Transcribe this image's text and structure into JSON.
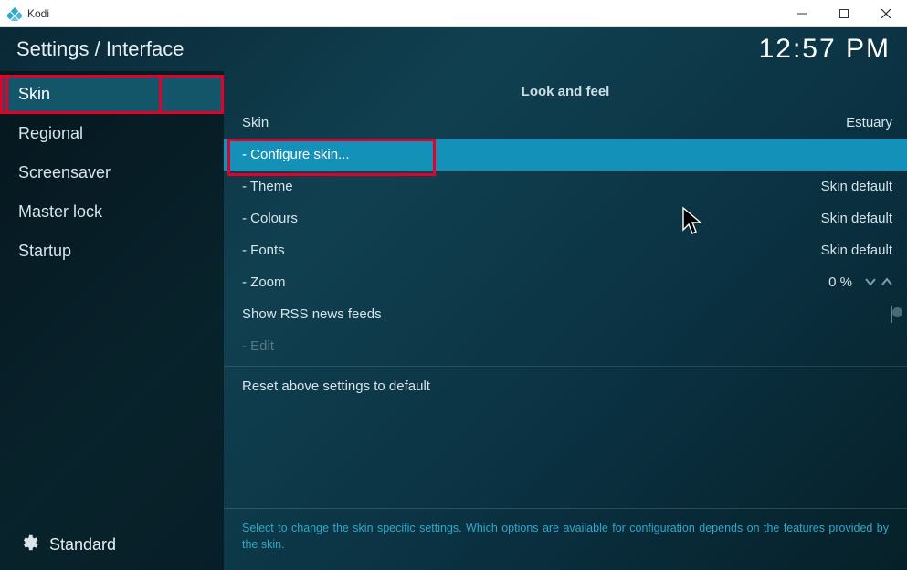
{
  "titlebar": {
    "app_name": "Kodi"
  },
  "header": {
    "breadcrumb": "Settings / Interface",
    "clock": "12:57 PM"
  },
  "sidebar": {
    "items": [
      {
        "label": "Skin",
        "active": true,
        "highlighted": true
      },
      {
        "label": "Regional",
        "active": false
      },
      {
        "label": "Screensaver",
        "active": false
      },
      {
        "label": "Master lock",
        "active": false
      },
      {
        "label": "Startup",
        "active": false
      }
    ],
    "footer": {
      "level_label": "Standard"
    }
  },
  "main": {
    "section_title": "Look and feel",
    "rows": [
      {
        "key": "skin",
        "label": "Skin",
        "value": "Estuary",
        "type": "nav"
      },
      {
        "key": "configure",
        "label": "- Configure skin...",
        "value": "",
        "type": "nav",
        "highlighted": true
      },
      {
        "key": "theme",
        "label": "- Theme",
        "value": "Skin default",
        "type": "nav"
      },
      {
        "key": "colours",
        "label": "- Colours",
        "value": "Skin default",
        "type": "nav"
      },
      {
        "key": "fonts",
        "label": "- Fonts",
        "value": "Skin default",
        "type": "nav"
      },
      {
        "key": "zoom",
        "label": "- Zoom",
        "value": "0 %",
        "type": "spinner"
      },
      {
        "key": "rss",
        "label": "Show RSS news feeds",
        "value": "",
        "type": "toggle",
        "toggled": false
      },
      {
        "key": "edit",
        "label": "- Edit",
        "value": "",
        "type": "nav",
        "disabled": true
      },
      {
        "key": "reset",
        "label": "Reset above settings to default",
        "value": "",
        "type": "nav"
      }
    ],
    "description": "Select to change the skin specific settings. Which options are available for configuration depends on the features provided by the skin."
  }
}
